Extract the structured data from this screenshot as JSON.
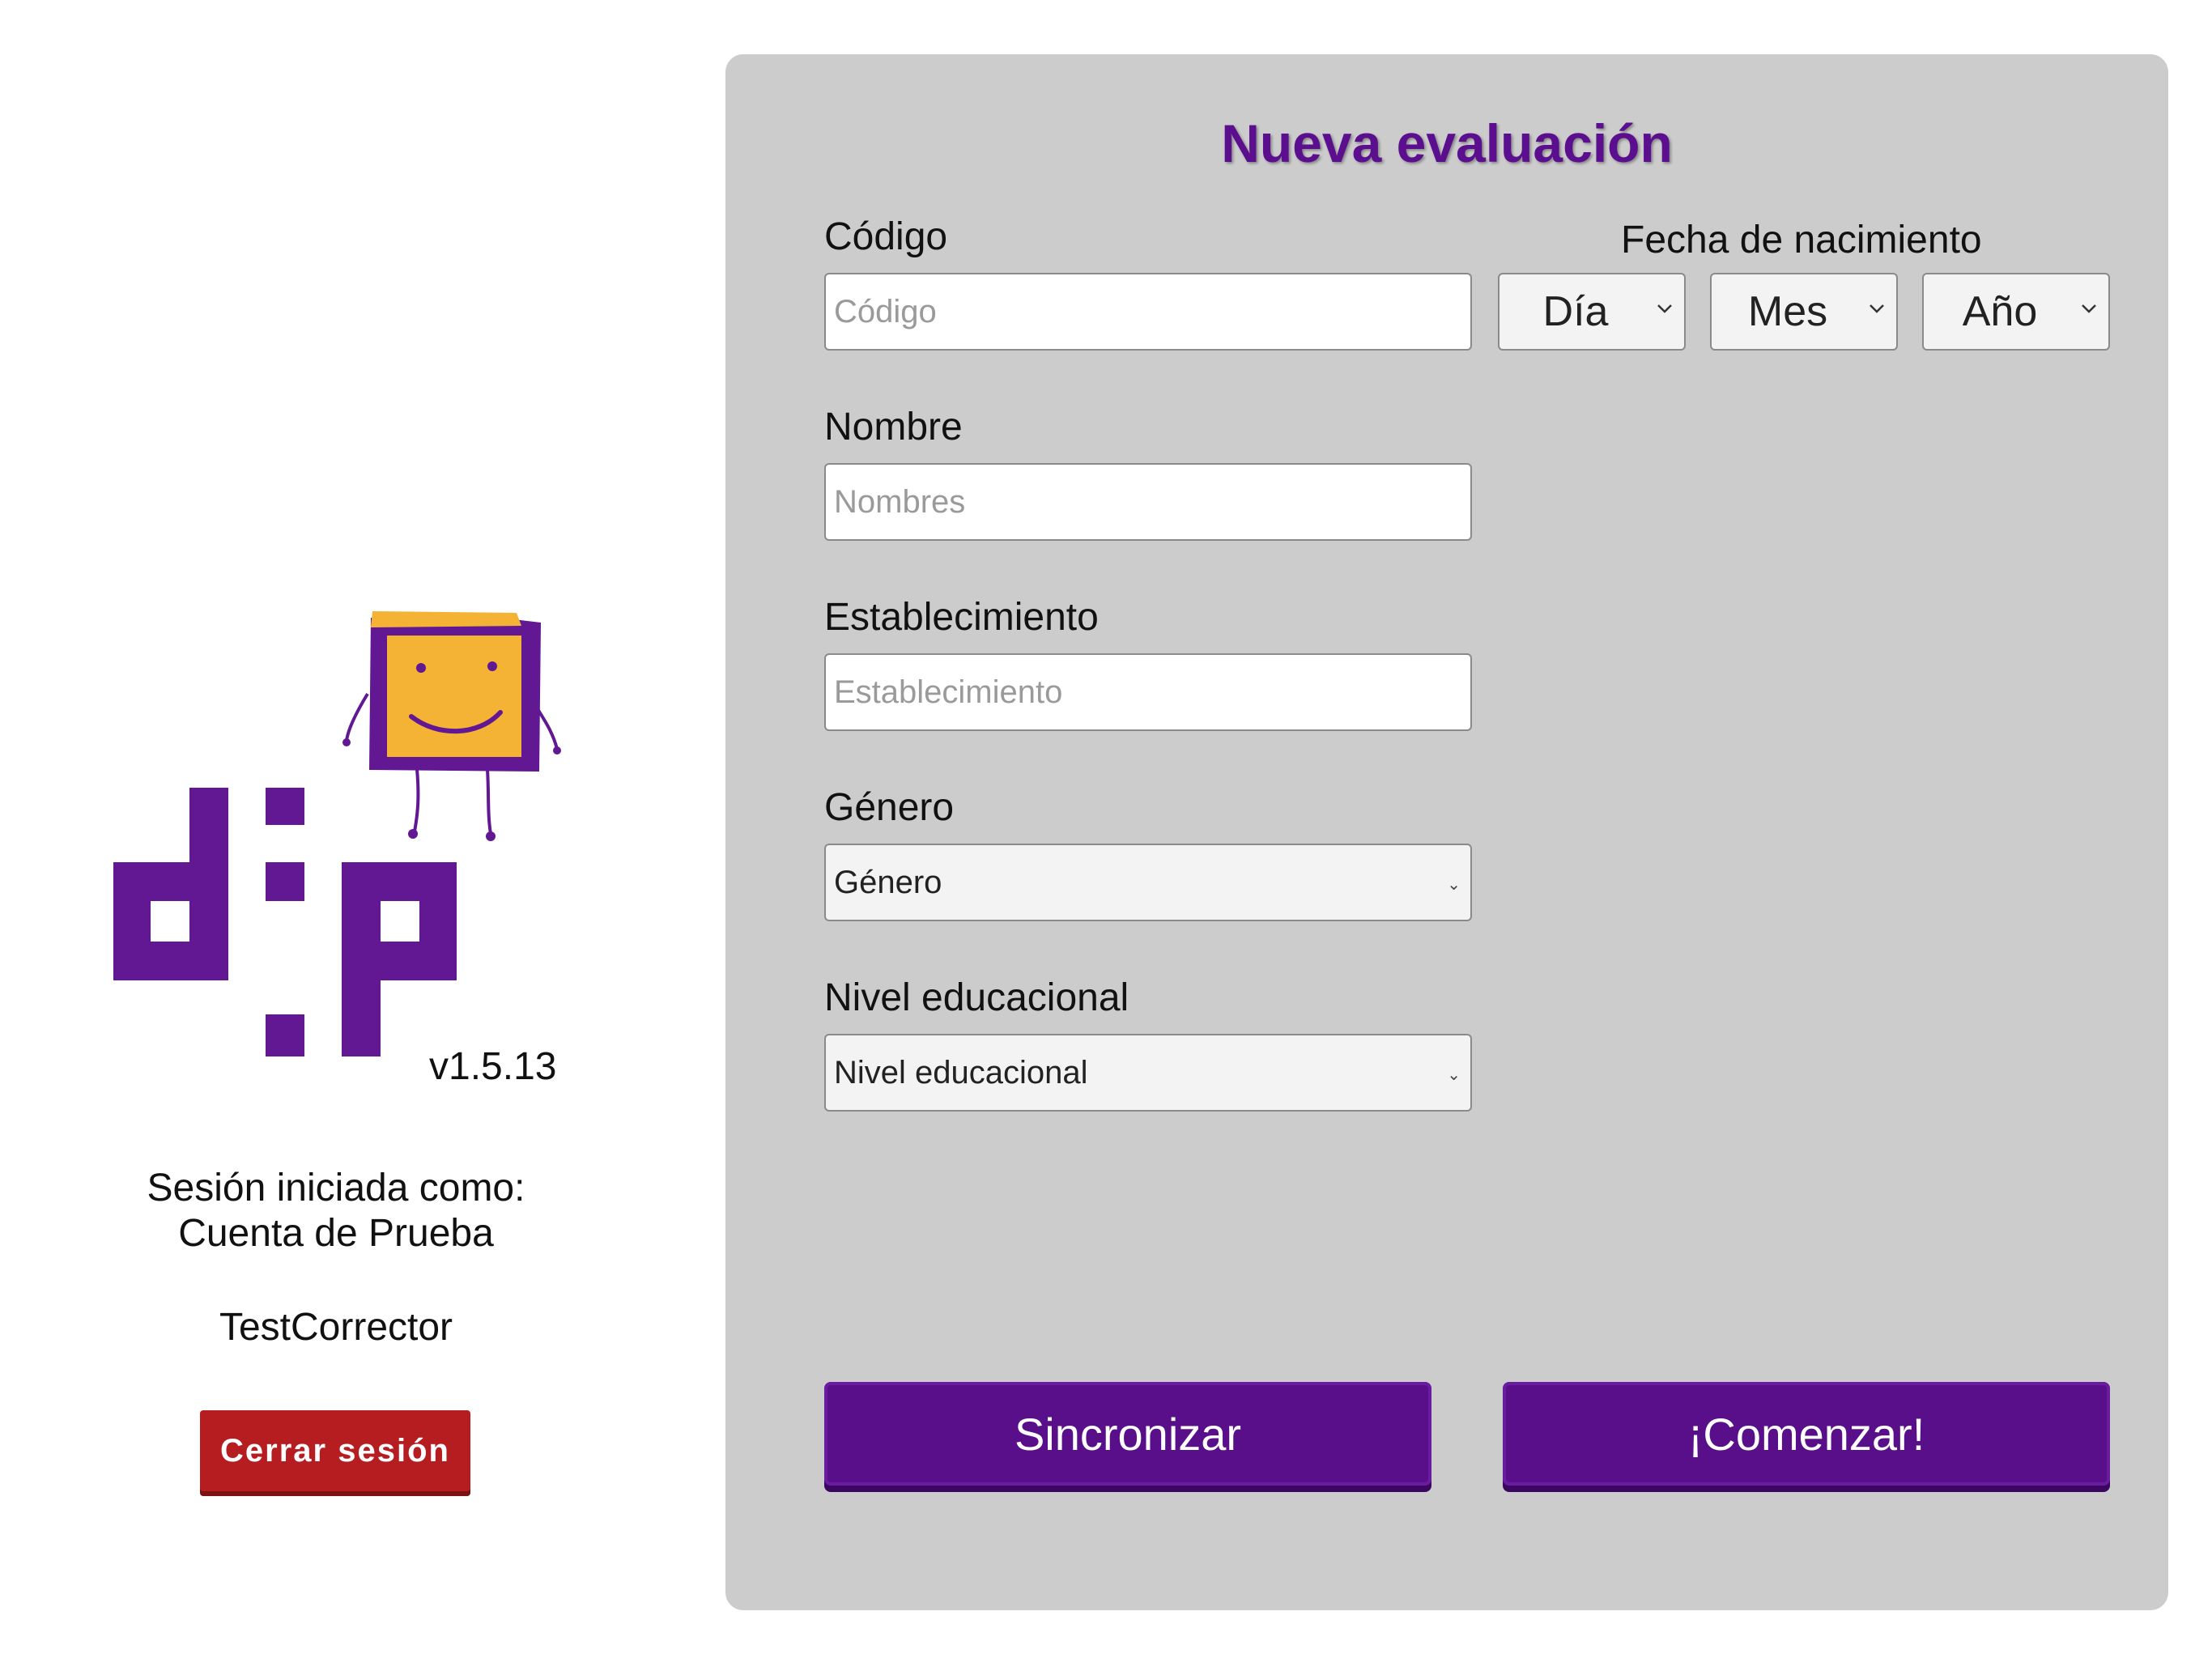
{
  "app": {
    "logo_text": "dip",
    "version": "v1.5.13"
  },
  "session": {
    "line1": "Sesión iniciada como:",
    "account": "Cuenta de Prueba",
    "username": "TestCorrector",
    "logout_label": "Cerrar sesión"
  },
  "form": {
    "title": "Nueva evaluación",
    "code": {
      "label": "Código",
      "placeholder": "Código",
      "value": ""
    },
    "birthdate": {
      "label": "Fecha de nacimiento",
      "day": "Día",
      "month": "Mes",
      "year": "Año"
    },
    "name": {
      "label": "Nombre",
      "placeholder": "Nombres",
      "value": ""
    },
    "school": {
      "label": "Establecimiento",
      "placeholder": "Establecimiento",
      "value": ""
    },
    "gender": {
      "label": "Género",
      "selected": "Género"
    },
    "education": {
      "label": "Nivel educacional",
      "selected": "Nivel educacional"
    },
    "sync_label": "Sincronizar",
    "start_label": "¡Comenzar!"
  },
  "colors": {
    "brand_purple": "#5a0f8a",
    "logo_purple": "#621793",
    "logo_orange": "#f5b335",
    "logout_red": "#b51d20",
    "panel_gray": "#cccccc"
  }
}
